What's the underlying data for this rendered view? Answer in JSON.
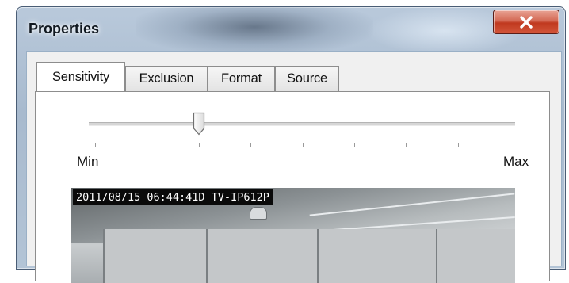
{
  "window": {
    "title": "Properties",
    "close_icon": "close-x-icon",
    "close_button_color": "#c8442a"
  },
  "tabs": [
    {
      "label": "Sensitivity",
      "active": true
    },
    {
      "label": "Exclusion",
      "active": false
    },
    {
      "label": "Format",
      "active": false
    },
    {
      "label": "Source",
      "active": false
    }
  ],
  "sensitivity": {
    "slider": {
      "min_label": "Min",
      "max_label": "Max",
      "value_fraction": 0.25,
      "tick_count": 9
    }
  },
  "camera_preview": {
    "timestamp_overlay": "2011/08/15 06:44:41D TV-IP612P"
  }
}
